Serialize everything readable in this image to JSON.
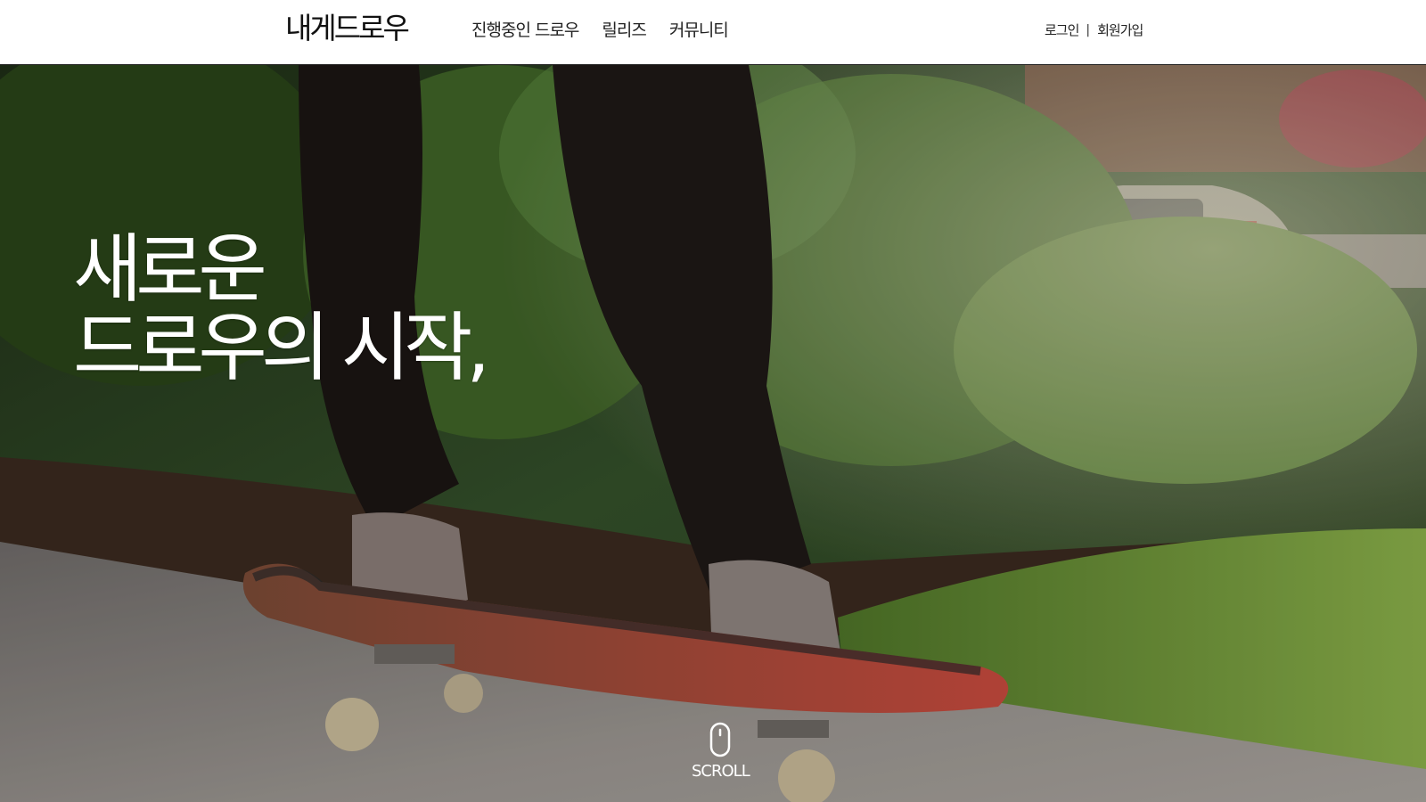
{
  "header": {
    "logo": "내게드로우",
    "nav": [
      {
        "label": "진행중인 드로우"
      },
      {
        "label": "릴리즈"
      },
      {
        "label": "커뮤니티"
      }
    ],
    "auth": {
      "login": "로그인",
      "separator": "|",
      "signup": "회원가입"
    }
  },
  "hero": {
    "headline_line1": "새로운",
    "headline_line2": "드로우의 시작,",
    "scroll_label": "SCROLL",
    "scroll_icon": "mouse-icon"
  },
  "colors": {
    "header_bg": "#ffffff",
    "text_dark": "#222222",
    "hero_text": "#ffffff",
    "foliage": "#2f4a1f",
    "grass": "#6f9a3a",
    "sidewalk": "#8e8a86",
    "deck_red": "#c2473c"
  }
}
